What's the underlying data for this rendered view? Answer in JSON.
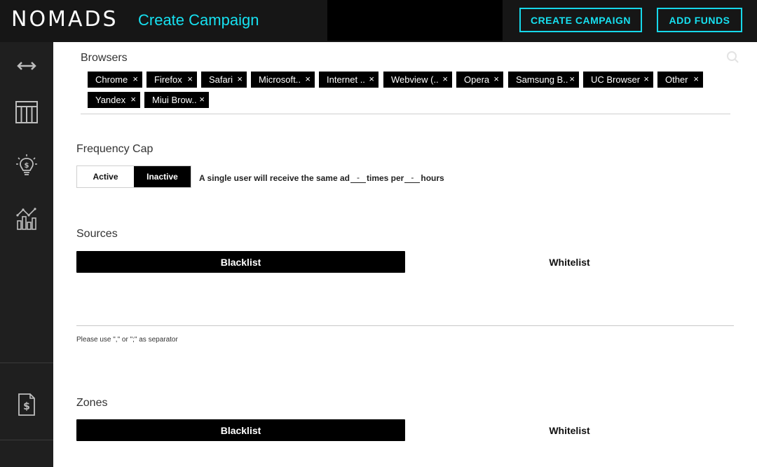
{
  "header": {
    "logo": "NOMADS",
    "title": "Create Campaign",
    "create_button": "CREATE CAMPAIGN",
    "funds_button": "ADD FUNDS",
    "accent": "#16e0f0"
  },
  "sidebar": {
    "items": [
      {
        "icon": "expand-arrows-icon"
      },
      {
        "icon": "table-icon"
      },
      {
        "icon": "lightbulb-dollar-icon"
      },
      {
        "icon": "analytics-chart-icon"
      },
      {
        "icon": "invoice-dollar-icon"
      }
    ]
  },
  "browsers": {
    "title": "Browsers",
    "chips": [
      "Chrome",
      "Firefox",
      "Safari",
      "Microsoft..",
      "Internet ..",
      "Webview (..",
      "Opera",
      "Samsung B..",
      "UC Browser",
      "Other",
      "Yandex",
      "Miui Brow.."
    ]
  },
  "frequency": {
    "title": "Frequency Cap",
    "active_label": "Active",
    "inactive_label": "Inactive",
    "text_part1": "A single user will receive the same ad",
    "blank1": "-",
    "text_part2": "times per",
    "blank2": "-",
    "text_part3": "hours"
  },
  "sources": {
    "title": "Sources",
    "blacklist": "Blacklist",
    "whitelist": "Whitelist",
    "hint": "Please use \",\" or \";\" as separator"
  },
  "zones": {
    "title": "Zones",
    "blacklist": "Blacklist",
    "whitelist": "Whitelist"
  }
}
